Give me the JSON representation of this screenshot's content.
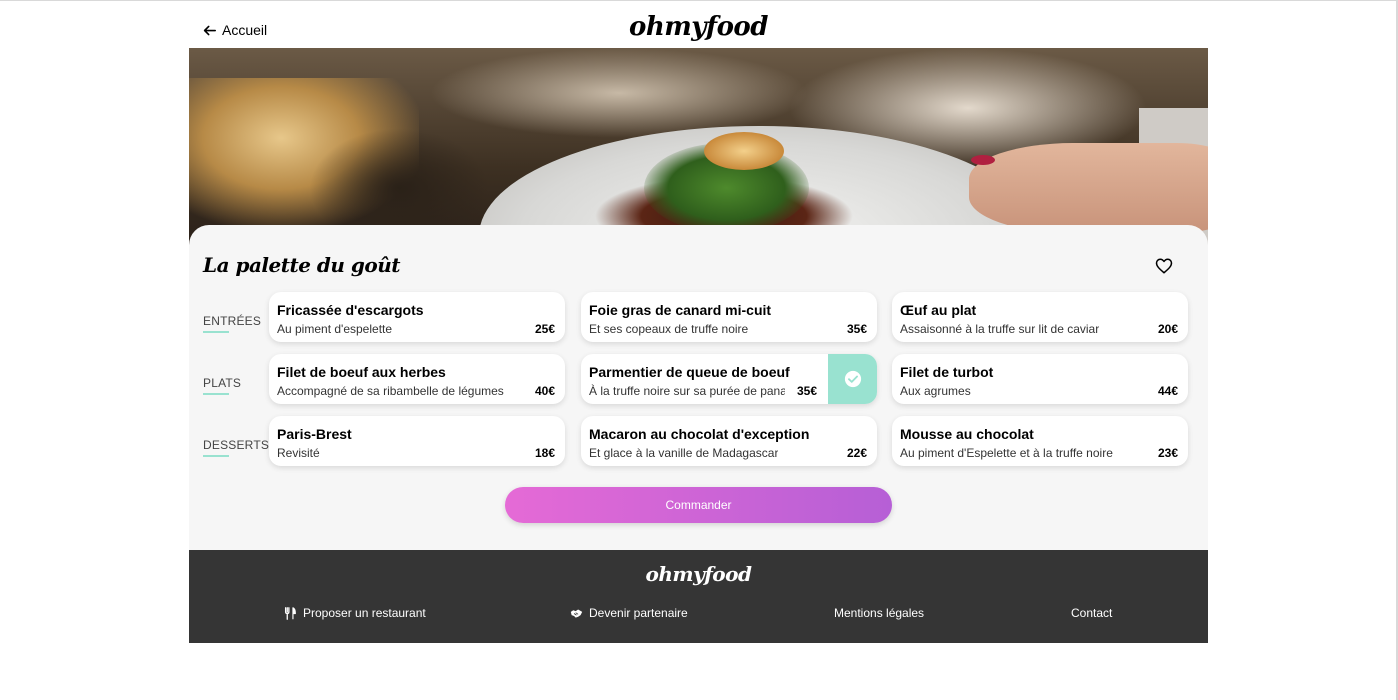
{
  "header": {
    "back_label": "Accueil",
    "logo": "ohmyfood"
  },
  "menu": {
    "title": "La palette du goût",
    "categories": [
      {
        "label": "ENTRÉES",
        "dishes": [
          {
            "name": "Fricassée d'escargots",
            "description": "Au piment d'espelette",
            "price": "25€"
          },
          {
            "name": "Foie gras de canard mi-cuit",
            "description": "Et ses copeaux de truffe noire",
            "price": "35€"
          },
          {
            "name": "Œuf au plat",
            "description": "Assaisonné à la truffe sur lit de caviar",
            "price": "20€"
          }
        ]
      },
      {
        "label": "PLATS",
        "dishes": [
          {
            "name": "Filet de boeuf aux herbes",
            "description": "Accompagné de sa ribambelle de légumes",
            "price": "40€"
          },
          {
            "name": "Parmentier de queue de boeuf",
            "description": "À la truffe noire sur sa purée de panais",
            "price": "35€",
            "selected": true
          },
          {
            "name": "Filet de turbot",
            "description": "Aux agrumes",
            "price": "44€"
          }
        ]
      },
      {
        "label": "DESSERTS",
        "dishes": [
          {
            "name": "Paris-Brest",
            "description": "Revisité",
            "price": "18€"
          },
          {
            "name": "Macaron au chocolat d'exception",
            "description": "Et glace à la vanille de Madagascar",
            "price": "22€"
          },
          {
            "name": "Mousse au chocolat",
            "description": "Au piment d'Espelette et à la truffe noire",
            "price": "23€"
          }
        ]
      }
    ],
    "order_label": "Commander"
  },
  "footer": {
    "logo": "ohmyfood",
    "links": [
      {
        "label": "Proposer un restaurant",
        "icon": "utensils-icon"
      },
      {
        "label": "Devenir partenaire",
        "icon": "handshake-icon"
      },
      {
        "label": "Mentions légales",
        "icon": ""
      },
      {
        "label": "Contact",
        "icon": ""
      }
    ]
  },
  "colors": {
    "accent_mint": "#99e2d0",
    "gradient_start": "#e56ad6",
    "gradient_end": "#b65fd6",
    "footer_bg": "#353535",
    "card_bg": "#f6f6f6"
  }
}
